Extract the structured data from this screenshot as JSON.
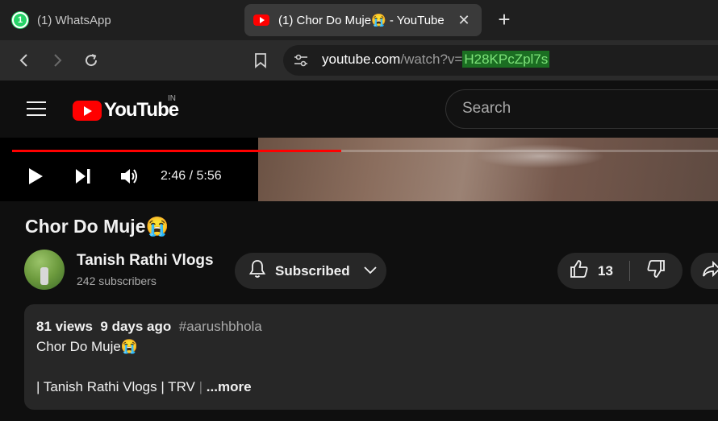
{
  "browser": {
    "tabs": [
      {
        "title": "(1) WhatsApp",
        "badge": "1",
        "active": false
      },
      {
        "title": "(1) Chor Do Muje😭 - YouTube",
        "active": true
      }
    ],
    "address": {
      "host": "youtube.com",
      "path": "/watch?v=",
      "highlighted": "H28KPcZpl7s"
    },
    "icons": [
      "back-icon",
      "forward-icon",
      "reload-icon",
      "bookmark-icon",
      "site-settings-icon",
      "close-icon",
      "plus-icon"
    ]
  },
  "youtube": {
    "logo_text": "YouTube",
    "country_code": "IN",
    "search_placeholder": "Search",
    "player": {
      "time": "2:46 / 5:56",
      "progress_fraction": 0.4663
    },
    "video": {
      "title": "Chor Do Muje😭",
      "channel_name": "Tanish Rathi Vlogs",
      "subscribers": "242 subscribers",
      "subscribe_label": "Subscribed",
      "like_count": "13"
    },
    "description": {
      "views": "81 views",
      "age": "9 days ago",
      "hashtag": "#aarushbhola",
      "line1": "Chor Do Muje😭",
      "line2_main": "| Tanish Rathi Vlogs | TRV",
      "line2_sep": "|",
      "more_label": "...more"
    }
  },
  "colors": {
    "accent_red": "#ff0000",
    "url_highlight_bg": "#1b6e22",
    "url_highlight_fg": "#7ee37a",
    "whatsapp_green": "#25d366"
  }
}
